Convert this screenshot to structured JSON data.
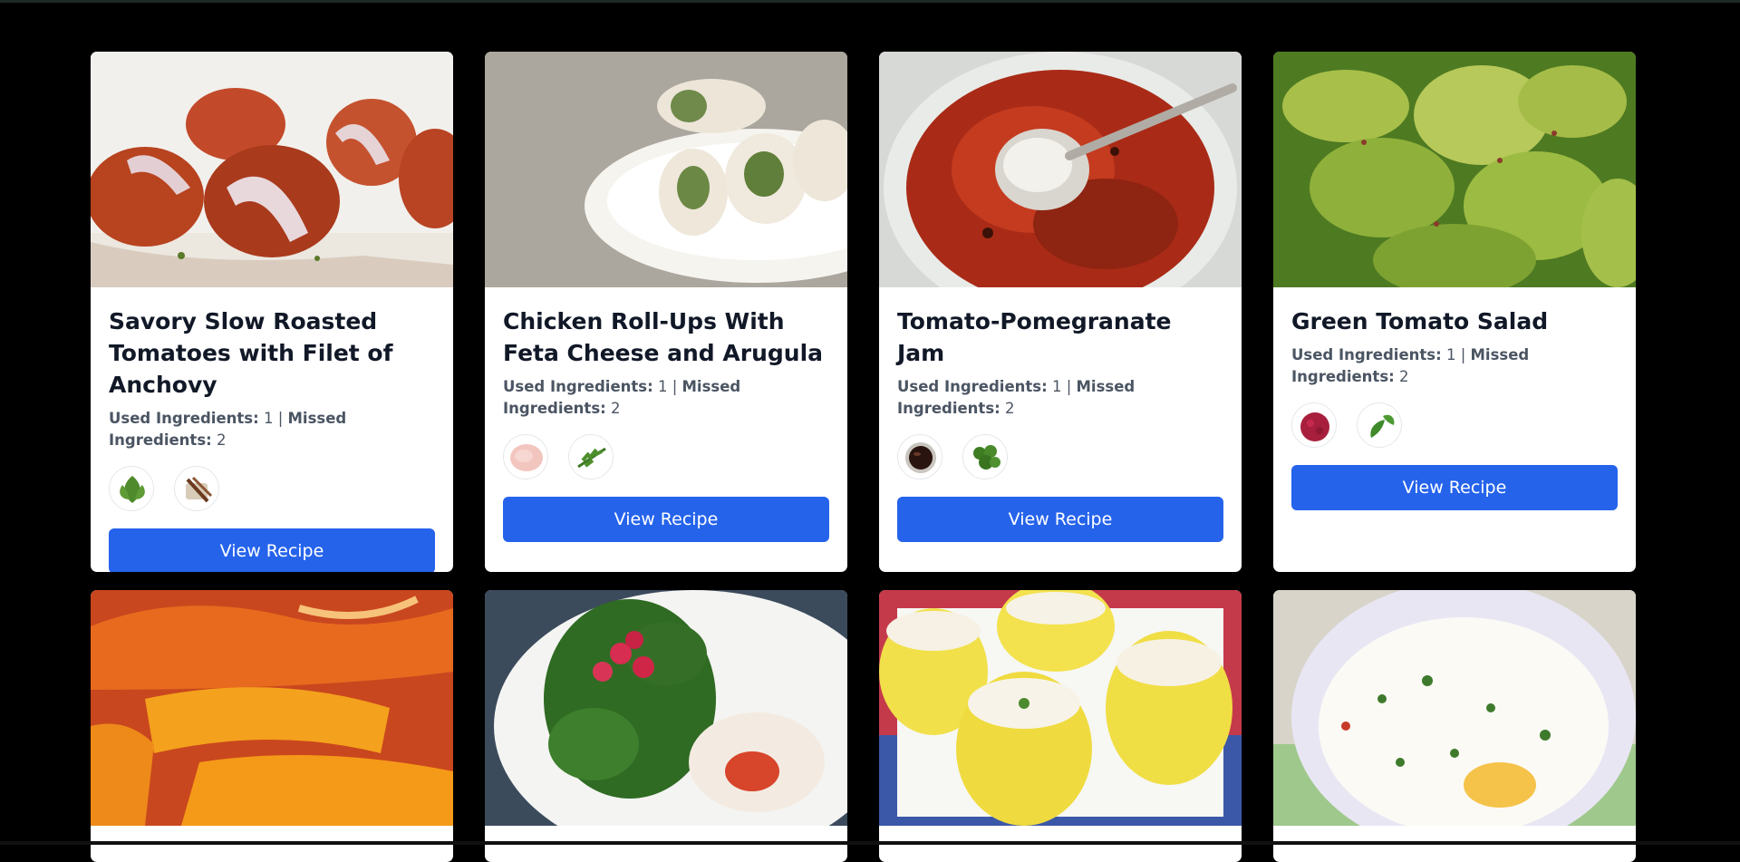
{
  "ui": {
    "accent": "#2563eb",
    "used_label": "Used Ingredients:",
    "missed_label": "Missed Ingredients:",
    "separator": "|",
    "button_label": "View Recipe"
  },
  "recipes": [
    {
      "title": "Savory Slow Roasted Tomatoes with Filet of Anchovy",
      "used": "1",
      "missed": "2",
      "ingredients": [
        "mint-leaves",
        "anchovy-fillets"
      ]
    },
    {
      "title": "Chicken Roll-Ups With Feta Cheese and Arugula",
      "used": "1",
      "missed": "2",
      "ingredients": [
        "chicken-breast",
        "arugula"
      ]
    },
    {
      "title": "Tomato-Pomegranate Jam",
      "used": "1",
      "missed": "2",
      "ingredients": [
        "pomegranate-molasses",
        "parsley"
      ]
    },
    {
      "title": "Green Tomato Salad",
      "used": "1",
      "missed": "2",
      "ingredients": [
        "sumac",
        "mint-sprig"
      ]
    }
  ],
  "second_row": [
    {
      "image": "roasted-peppers"
    },
    {
      "image": "spinach-raspberry-plate"
    },
    {
      "image": "stuffed-lemons"
    },
    {
      "image": "baked-eggs-herbs"
    }
  ]
}
